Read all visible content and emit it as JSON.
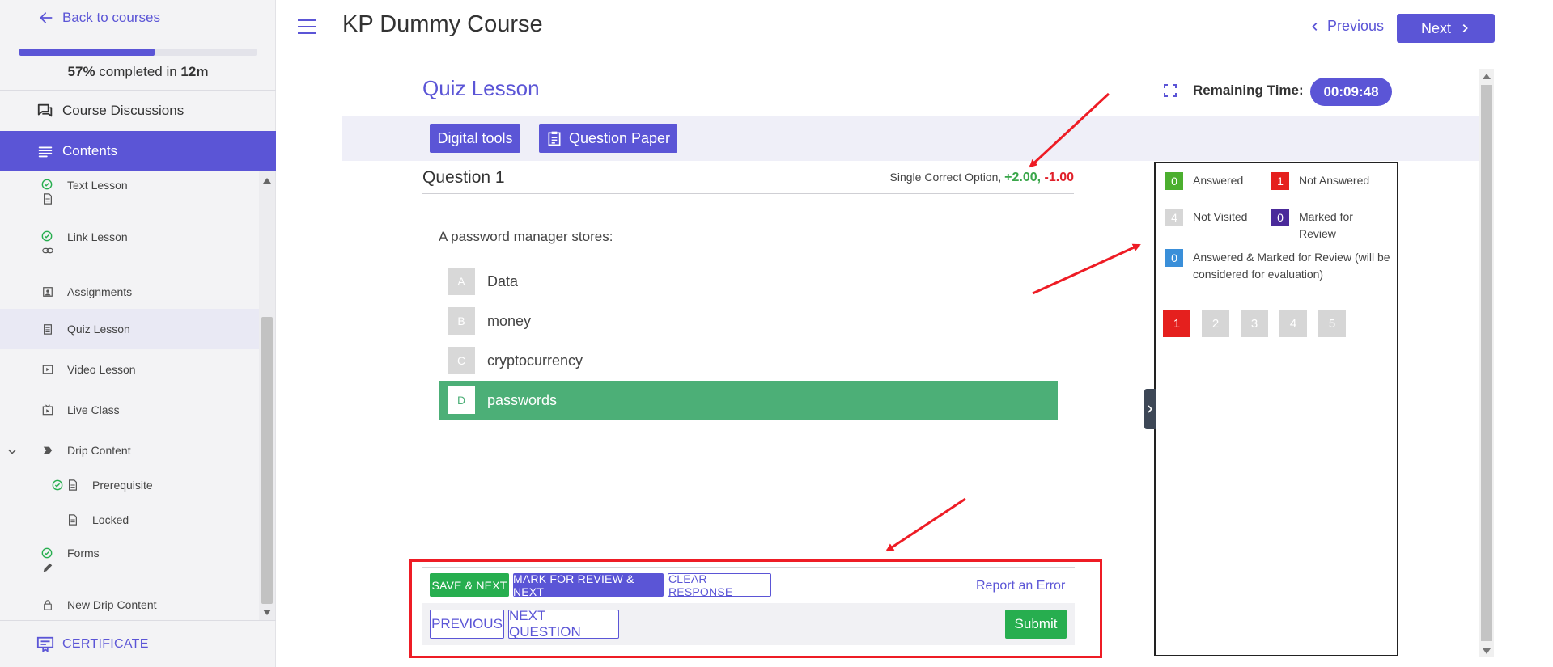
{
  "sidebar": {
    "back_label": "Back to courses",
    "progress_fraction": 0.57,
    "progress_percent": "57%",
    "progress_middle": " completed in ",
    "progress_time": "12m",
    "discussions_label": "Course Discussions",
    "contents_label": "Contents",
    "lessons": [
      {
        "label": "Text Lesson",
        "status": "completed",
        "icon": "document-icon"
      },
      {
        "label": "Link Lesson",
        "status": "completed",
        "icon": "link-icon"
      },
      {
        "label": "Assignments",
        "icon": "assignment-icon"
      },
      {
        "label": "Quiz Lesson",
        "icon": "quiz-icon",
        "current": true
      },
      {
        "label": "Video Lesson",
        "icon": "video-icon"
      },
      {
        "label": "Live Class",
        "icon": "live-class-icon"
      },
      {
        "label": "Drip Content",
        "icon": "drip-icon",
        "expanded": true
      },
      {
        "label": "Prerequisite",
        "status": "completed",
        "icon": "document-icon"
      },
      {
        "label": "Locked",
        "icon": "document-icon"
      },
      {
        "label": "Forms",
        "status": "completed",
        "icon": "pencil-icon"
      },
      {
        "label": "New Drip Content",
        "icon": "lock-icon"
      }
    ],
    "certificate_label": "CERTIFICATE"
  },
  "header": {
    "course_title": "KP Dummy Course",
    "previous_label": "Previous",
    "next_label": "Next"
  },
  "quiz": {
    "title": "Quiz Lesson",
    "remaining_label": "Remaining Time:",
    "remaining_time": "00:09:48",
    "tools": {
      "digital_tools": "Digital tools",
      "question_paper": "Question Paper"
    },
    "question_label": "Question 1",
    "question_type": "Single Correct Option, ",
    "marks_positive": "+2.00",
    "marks_sep": ", ",
    "marks_negative": "-1.00",
    "question_text": "A password manager stores:",
    "options": [
      {
        "letter": "A",
        "text": "Data"
      },
      {
        "letter": "B",
        "text": "money"
      },
      {
        "letter": "C",
        "text": "cryptocurrency"
      },
      {
        "letter": "D",
        "text": "passwords",
        "selected": true
      }
    ],
    "actions": {
      "save_next": "SAVE & NEXT",
      "mark_review_next": "MARK FOR REVIEW & NEXT",
      "clear_response": "CLEAR RESPONSE",
      "report_error": "Report an Error",
      "previous": "PREVIOUS",
      "next_question": "NEXT QUESTION",
      "submit": "Submit"
    }
  },
  "legend": {
    "answered": {
      "count": "0",
      "label": "Answered",
      "color": "#4caf2f"
    },
    "not_answered": {
      "count": "1",
      "label": "Not Answered",
      "color": "#e5201e"
    },
    "not_visited": {
      "count": "4",
      "label": "Not Visited",
      "color": "#d6d6d6"
    },
    "marked_review": {
      "count": "0",
      "label": "Marked for Review",
      "color": "#4a2a9a"
    },
    "answered_marked": {
      "count": "0",
      "label": "Answered & Marked for Review (will be considered for evaluation)",
      "color": "#3a8fd9"
    },
    "question_numbers": [
      "1",
      "2",
      "3",
      "4",
      "5"
    ]
  },
  "colors": {
    "accent": "#5b55d6",
    "success": "#27ae4f",
    "selected_option": "#4caf77",
    "danger": "#ee1c25"
  }
}
